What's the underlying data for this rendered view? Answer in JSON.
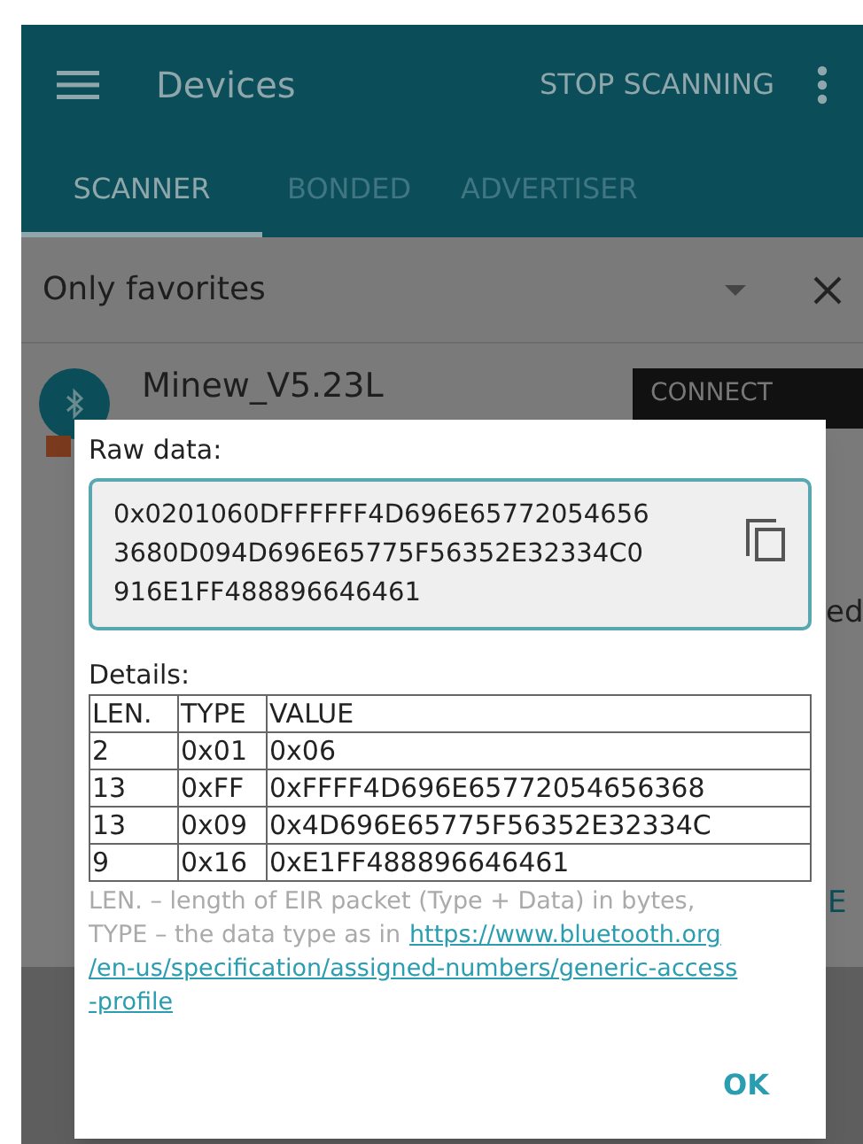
{
  "toolbar": {
    "title": "Devices",
    "action": "STOP SCANNING"
  },
  "tabs": [
    {
      "label": "SCANNER",
      "selected": true
    },
    {
      "label": "BONDED",
      "selected": false
    },
    {
      "label": "ADVERTISER",
      "selected": false
    }
  ],
  "filter": {
    "value": "Only favorites"
  },
  "device": {
    "name": "Minew_V5.23L",
    "connect": "CONNECT",
    "partial_right_1": "ed",
    "partial_right_2": "E"
  },
  "dialog": {
    "raw_label": "Raw data:",
    "raw_value": "0x0201060DFFFFFF4D696E65772054656\n3680D094D696E65775F56352E32334C0\n916E1FF488896646461",
    "details_label": "Details:",
    "columns": [
      "LEN.",
      "TYPE",
      "VALUE"
    ],
    "rows": [
      [
        "2",
        "0x01",
        "0x06"
      ],
      [
        "13",
        "0xFF",
        "0xFFFF4D696E65772054656368"
      ],
      [
        "13",
        "0x09",
        "0x4D696E65775F56352E32334C"
      ],
      [
        "9",
        "0x16",
        "0xE1FF488896646461"
      ]
    ],
    "note_1": "LEN. – length of EIR packet (Type + Data) in bytes,",
    "note_2": "TYPE – the data type as in",
    "link_lines": [
      "https://www.bluetooth.org",
      "/en-us/specification/assigned-numbers/generic-access",
      "-profile"
    ],
    "ok": "OK"
  }
}
